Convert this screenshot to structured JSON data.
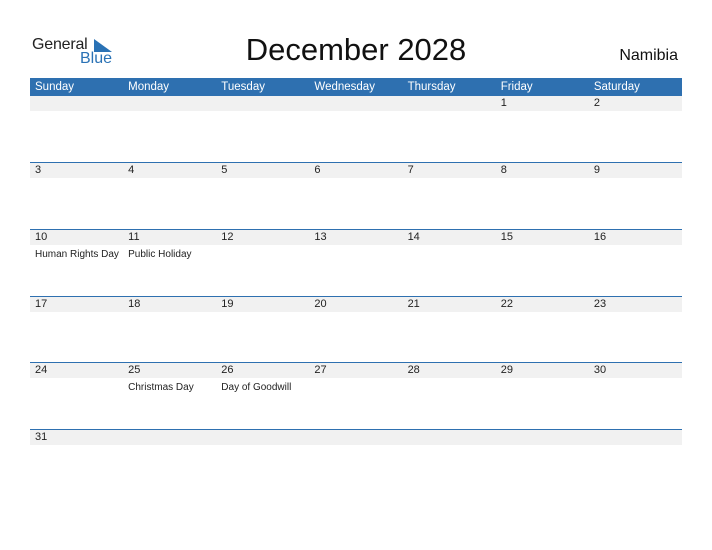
{
  "brand": {
    "general": "General",
    "blue": "Blue"
  },
  "title": "December 2028",
  "country": "Namibia",
  "weekdays": [
    "Sunday",
    "Monday",
    "Tuesday",
    "Wednesday",
    "Thursday",
    "Friday",
    "Saturday"
  ],
  "weeks": [
    [
      {
        "day": ""
      },
      {
        "day": ""
      },
      {
        "day": ""
      },
      {
        "day": ""
      },
      {
        "day": ""
      },
      {
        "day": "1"
      },
      {
        "day": "2"
      }
    ],
    [
      {
        "day": "3"
      },
      {
        "day": "4"
      },
      {
        "day": "5"
      },
      {
        "day": "6"
      },
      {
        "day": "7"
      },
      {
        "day": "8"
      },
      {
        "day": "9"
      }
    ],
    [
      {
        "day": "10",
        "holiday": "Human Rights Day"
      },
      {
        "day": "11",
        "holiday": "Public Holiday"
      },
      {
        "day": "12"
      },
      {
        "day": "13"
      },
      {
        "day": "14"
      },
      {
        "day": "15"
      },
      {
        "day": "16"
      }
    ],
    [
      {
        "day": "17"
      },
      {
        "day": "18"
      },
      {
        "day": "19"
      },
      {
        "day": "20"
      },
      {
        "day": "21"
      },
      {
        "day": "22"
      },
      {
        "day": "23"
      }
    ],
    [
      {
        "day": "24"
      },
      {
        "day": "25",
        "holiday": "Christmas Day"
      },
      {
        "day": "26",
        "holiday": "Day of Goodwill"
      },
      {
        "day": "27"
      },
      {
        "day": "28"
      },
      {
        "day": "29"
      },
      {
        "day": "30"
      }
    ],
    [
      {
        "day": "31"
      },
      {
        "day": ""
      },
      {
        "day": ""
      },
      {
        "day": ""
      },
      {
        "day": ""
      },
      {
        "day": ""
      },
      {
        "day": ""
      }
    ]
  ]
}
